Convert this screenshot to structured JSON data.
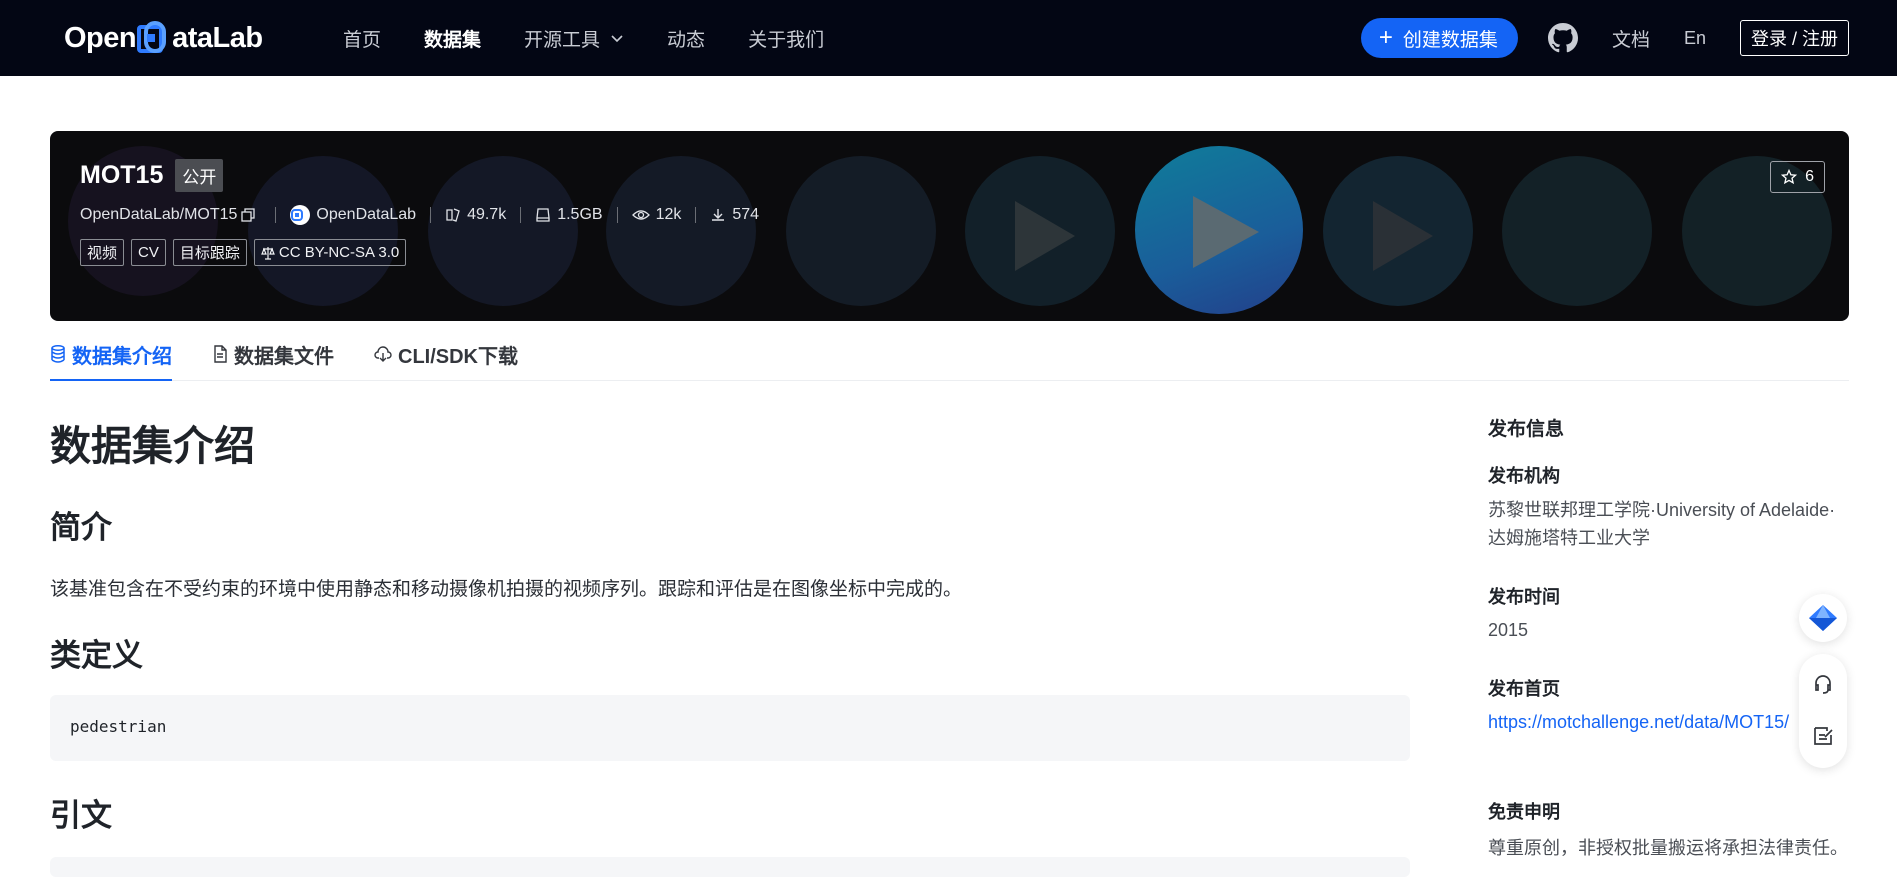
{
  "nav": {
    "logo_open": "Open",
    "logo_rest": "ataLab",
    "links": [
      "首页",
      "数据集",
      "开源工具",
      "动态",
      "关于我们"
    ],
    "create_label": "创建数据集",
    "docs_label": "文档",
    "lang_label": "En",
    "login_label": "登录 / 注册"
  },
  "banner": {
    "title": "MOT15",
    "public_label": "公开",
    "repo": "OpenDataLab/MOT15",
    "org": "OpenDataLab",
    "size_count": "49.7k",
    "storage": "1.5GB",
    "views": "12k",
    "downloads": "574",
    "tags": [
      "视频",
      "CV",
      "目标跟踪"
    ],
    "license": "CC BY-NC-SA 3.0",
    "stars": "6"
  },
  "tabs": [
    "数据集介绍",
    "数据集文件",
    "CLI/SDK下载"
  ],
  "content": {
    "heading": "数据集介绍",
    "intro_heading": "简介",
    "intro_text": "该基准包含在不受约束的环境中使用静态和移动摄像机拍摄的视频序列。跟踪和评估是在图像坐标中完成的。",
    "class_heading": "类定义",
    "class_code": "pedestrian",
    "cite_heading": "引文"
  },
  "sidebar": {
    "title": "发布信息",
    "org_label": "发布机构",
    "org_value": "苏黎世联邦理工学院·University of Adelaide·达姆施塔特工业大学",
    "time_label": "发布时间",
    "time_value": "2015",
    "home_label": "发布首页",
    "home_value": "https://motchallenge.net/data/MOT15/",
    "disclaimer_label": "免责申明",
    "disclaimer_value": "尊重原创，非授权批量搬运将承担法律责任。"
  },
  "colors": {
    "nav_bg": "#030614",
    "accent": "#1464f5",
    "banner_bg": "#0b0b0d"
  }
}
